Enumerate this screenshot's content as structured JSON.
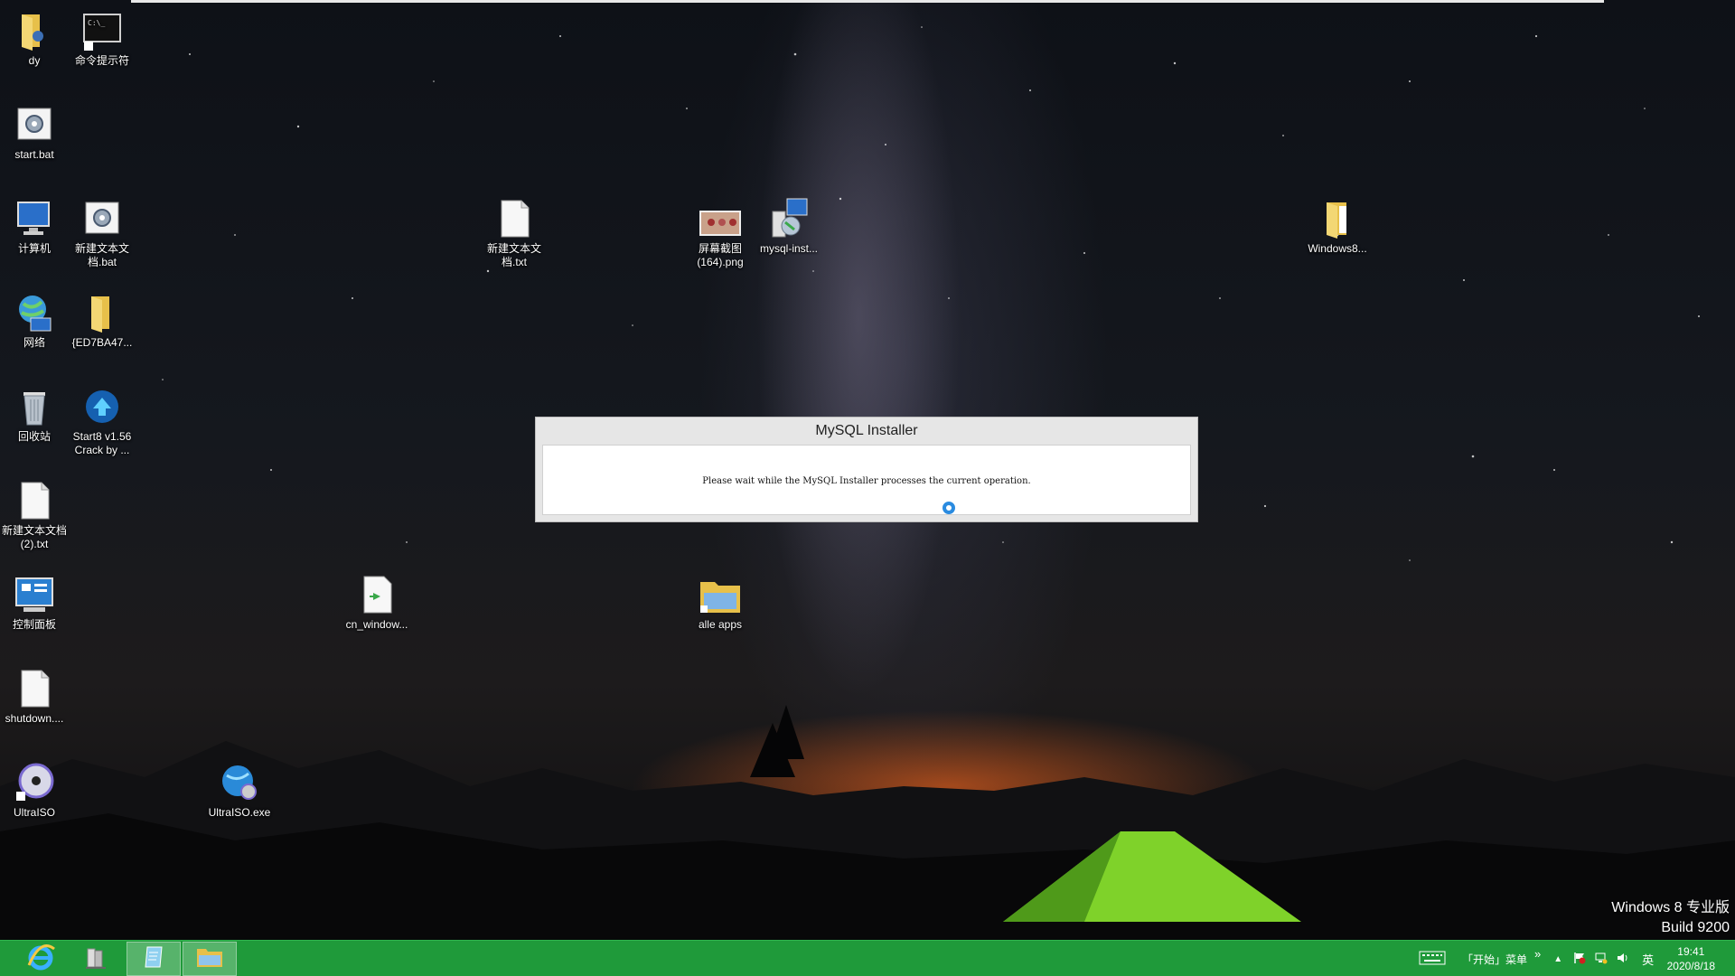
{
  "desktop": {
    "icons": [
      {
        "id": "dy",
        "label": "dy"
      },
      {
        "id": "cmd",
        "label": "命令提示符"
      },
      {
        "id": "start-bat",
        "label": "start.bat"
      },
      {
        "id": "computer",
        "label": "计算机"
      },
      {
        "id": "new-bat",
        "label": "新建文本文档.bat"
      },
      {
        "id": "network",
        "label": "网络"
      },
      {
        "id": "ed7ba47",
        "label": "{ED7BA47..."
      },
      {
        "id": "recycle",
        "label": "回收站"
      },
      {
        "id": "start8",
        "label": "Start8 v1.56 Crack by ..."
      },
      {
        "id": "newtxt2",
        "label": "新建文本文档 (2).txt"
      },
      {
        "id": "control",
        "label": "控制面板"
      },
      {
        "id": "shutdown",
        "label": "shutdown...."
      },
      {
        "id": "ultraiso",
        "label": "UltraISO"
      },
      {
        "id": "ultraiso-exe",
        "label": "UltraISO.exe"
      },
      {
        "id": "cn-window",
        "label": "cn_window..."
      },
      {
        "id": "newtxt",
        "label": "新建文本文档.txt"
      },
      {
        "id": "screenshot",
        "label": "屏幕截图 (164).png"
      },
      {
        "id": "mysql-inst",
        "label": "mysql-inst..."
      },
      {
        "id": "alle-apps",
        "label": "alle apps"
      },
      {
        "id": "windows8",
        "label": "Windows8..."
      }
    ]
  },
  "dialog": {
    "title": "MySQL Installer",
    "message": "Please wait while the MySQL Installer processes the current operation."
  },
  "watermark": {
    "line1": "Windows 8 专业版",
    "line2": "Build 9200"
  },
  "taskbar": {
    "menu_label": "「开始」菜单",
    "menu_chevron": "»",
    "ime": "英",
    "time": "19:41",
    "date": "2020/8/18"
  },
  "colors": {
    "taskbar": "#1f9a3a",
    "spinner": "#2a8be0"
  }
}
